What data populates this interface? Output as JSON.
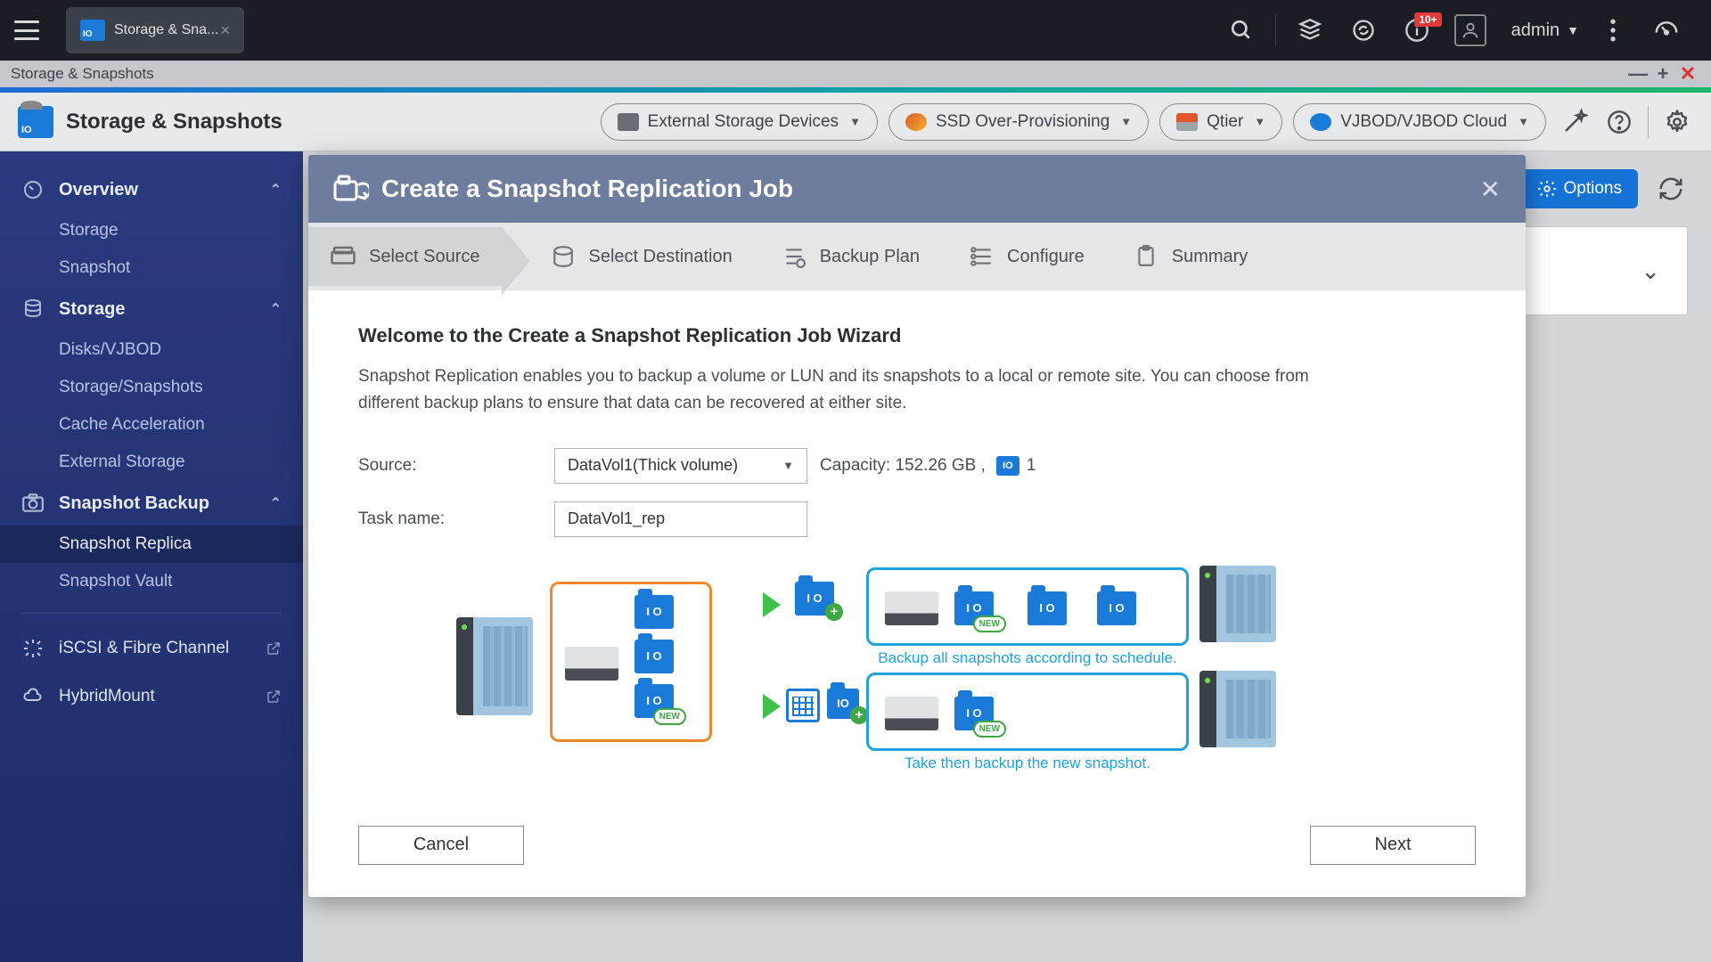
{
  "topbar": {
    "tab_label": "Storage & Sna...",
    "badge": "10+",
    "username": "admin"
  },
  "window": {
    "title": "Storage & Snapshots"
  },
  "toolbar": {
    "app_title": "Storage & Snapshots",
    "pills": {
      "external": "External Storage Devices",
      "ssd": "SSD Over-Provisioning",
      "qtier": "Qtier",
      "vjbod": "VJBOD/VJBOD Cloud"
    }
  },
  "sidebar": {
    "overview": {
      "label": "Overview",
      "storage": "Storage",
      "snapshot": "Snapshot"
    },
    "storage": {
      "label": "Storage",
      "disks": "Disks/VJBOD",
      "ss": "Storage/Snapshots",
      "cache": "Cache Acceleration",
      "ext": "External Storage"
    },
    "backup": {
      "label": "Snapshot Backup",
      "replica": "Snapshot Replica",
      "vault": "Snapshot Vault"
    },
    "iscsi": "iSCSI & Fibre Channel",
    "hybrid": "HybridMount"
  },
  "content": {
    "options_btn": "Options"
  },
  "modal": {
    "title": "Create a Snapshot Replication Job",
    "steps": {
      "s1": "Select Source",
      "s2": "Select Destination",
      "s3": "Backup Plan",
      "s4": "Configure",
      "s5": "Summary"
    },
    "welcome_title": "Welcome to the Create a Snapshot Replication Job Wizard",
    "welcome_desc": "Snapshot Replication enables you to backup a volume or LUN and its snapshots to a local or remote site. You can choose from different backup plans to ensure that data can be recovered at either site.",
    "source_label": "Source:",
    "source_value": "DataVol1(Thick volume)",
    "capacity_text": "Capacity: 152.26 GB ,",
    "capacity_count": "1",
    "task_label": "Task name:",
    "task_value": "DataVol1_rep",
    "diagram": {
      "caption1": "Backup all snapshots according to schedule.",
      "caption2": "Take then backup the new snapshot.",
      "new_badge": "NEW"
    },
    "cancel": "Cancel",
    "next": "Next"
  }
}
